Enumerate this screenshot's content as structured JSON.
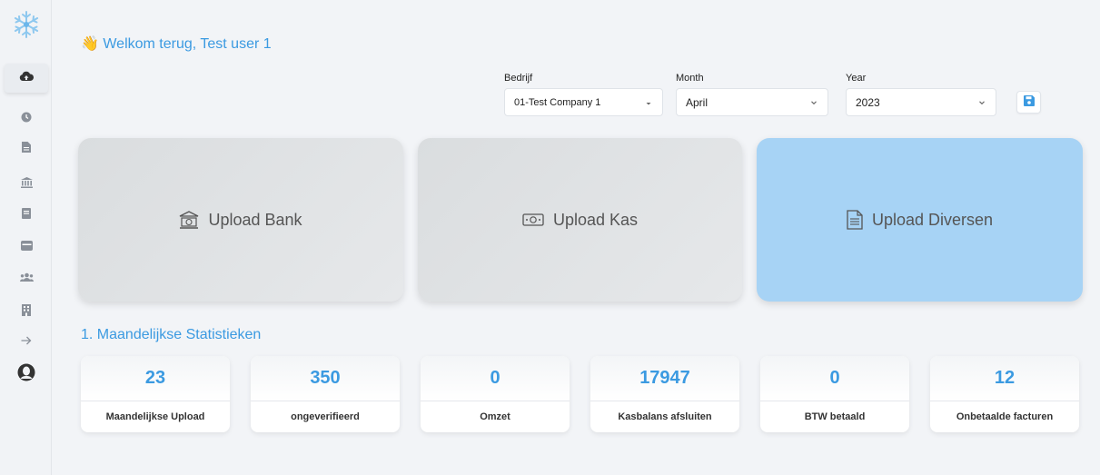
{
  "header": {
    "welcome": "👋 Welkom terug, Test user 1"
  },
  "filters": {
    "company": {
      "label": "Bedrijf",
      "value": "01-Test Company 1"
    },
    "month": {
      "label": "Month",
      "value": "April"
    },
    "year": {
      "label": "Year",
      "value": "2023"
    }
  },
  "sidebar": {
    "logo": "snowflake-icon",
    "items": [
      {
        "icon": "cloud-upload-icon"
      },
      {
        "icon": "clock-icon"
      },
      {
        "icon": "file-icon"
      },
      {
        "icon": "bank-icon"
      },
      {
        "icon": "book-icon"
      },
      {
        "icon": "store-icon"
      },
      {
        "icon": "users-icon"
      },
      {
        "icon": "building-icon"
      },
      {
        "icon": "arrow-right-icon"
      },
      {
        "icon": "user-avatar-icon"
      }
    ]
  },
  "uploads": [
    {
      "label": "Upload Bank",
      "icon": "bank-icon"
    },
    {
      "label": "Upload Kas",
      "icon": "money-icon"
    },
    {
      "label": "Upload Diversen",
      "icon": "document-icon"
    }
  ],
  "stats_section": {
    "title": "1. Maandelijkse Statistieken",
    "cards": [
      {
        "value": "23",
        "label": "Maandelijkse Upload"
      },
      {
        "value": "350",
        "label": "ongeverifieerd"
      },
      {
        "value": "0",
        "label": "Omzet"
      },
      {
        "value": "17947",
        "label": "Kasbalans afsluiten"
      },
      {
        "value": "0",
        "label": "BTW betaald"
      },
      {
        "value": "12",
        "label": "Onbetaalde facturen"
      }
    ]
  },
  "colors": {
    "accent": "#3b9ae1",
    "active_card": "#a7d3f5",
    "sidebar_icon": "#8a9099"
  }
}
